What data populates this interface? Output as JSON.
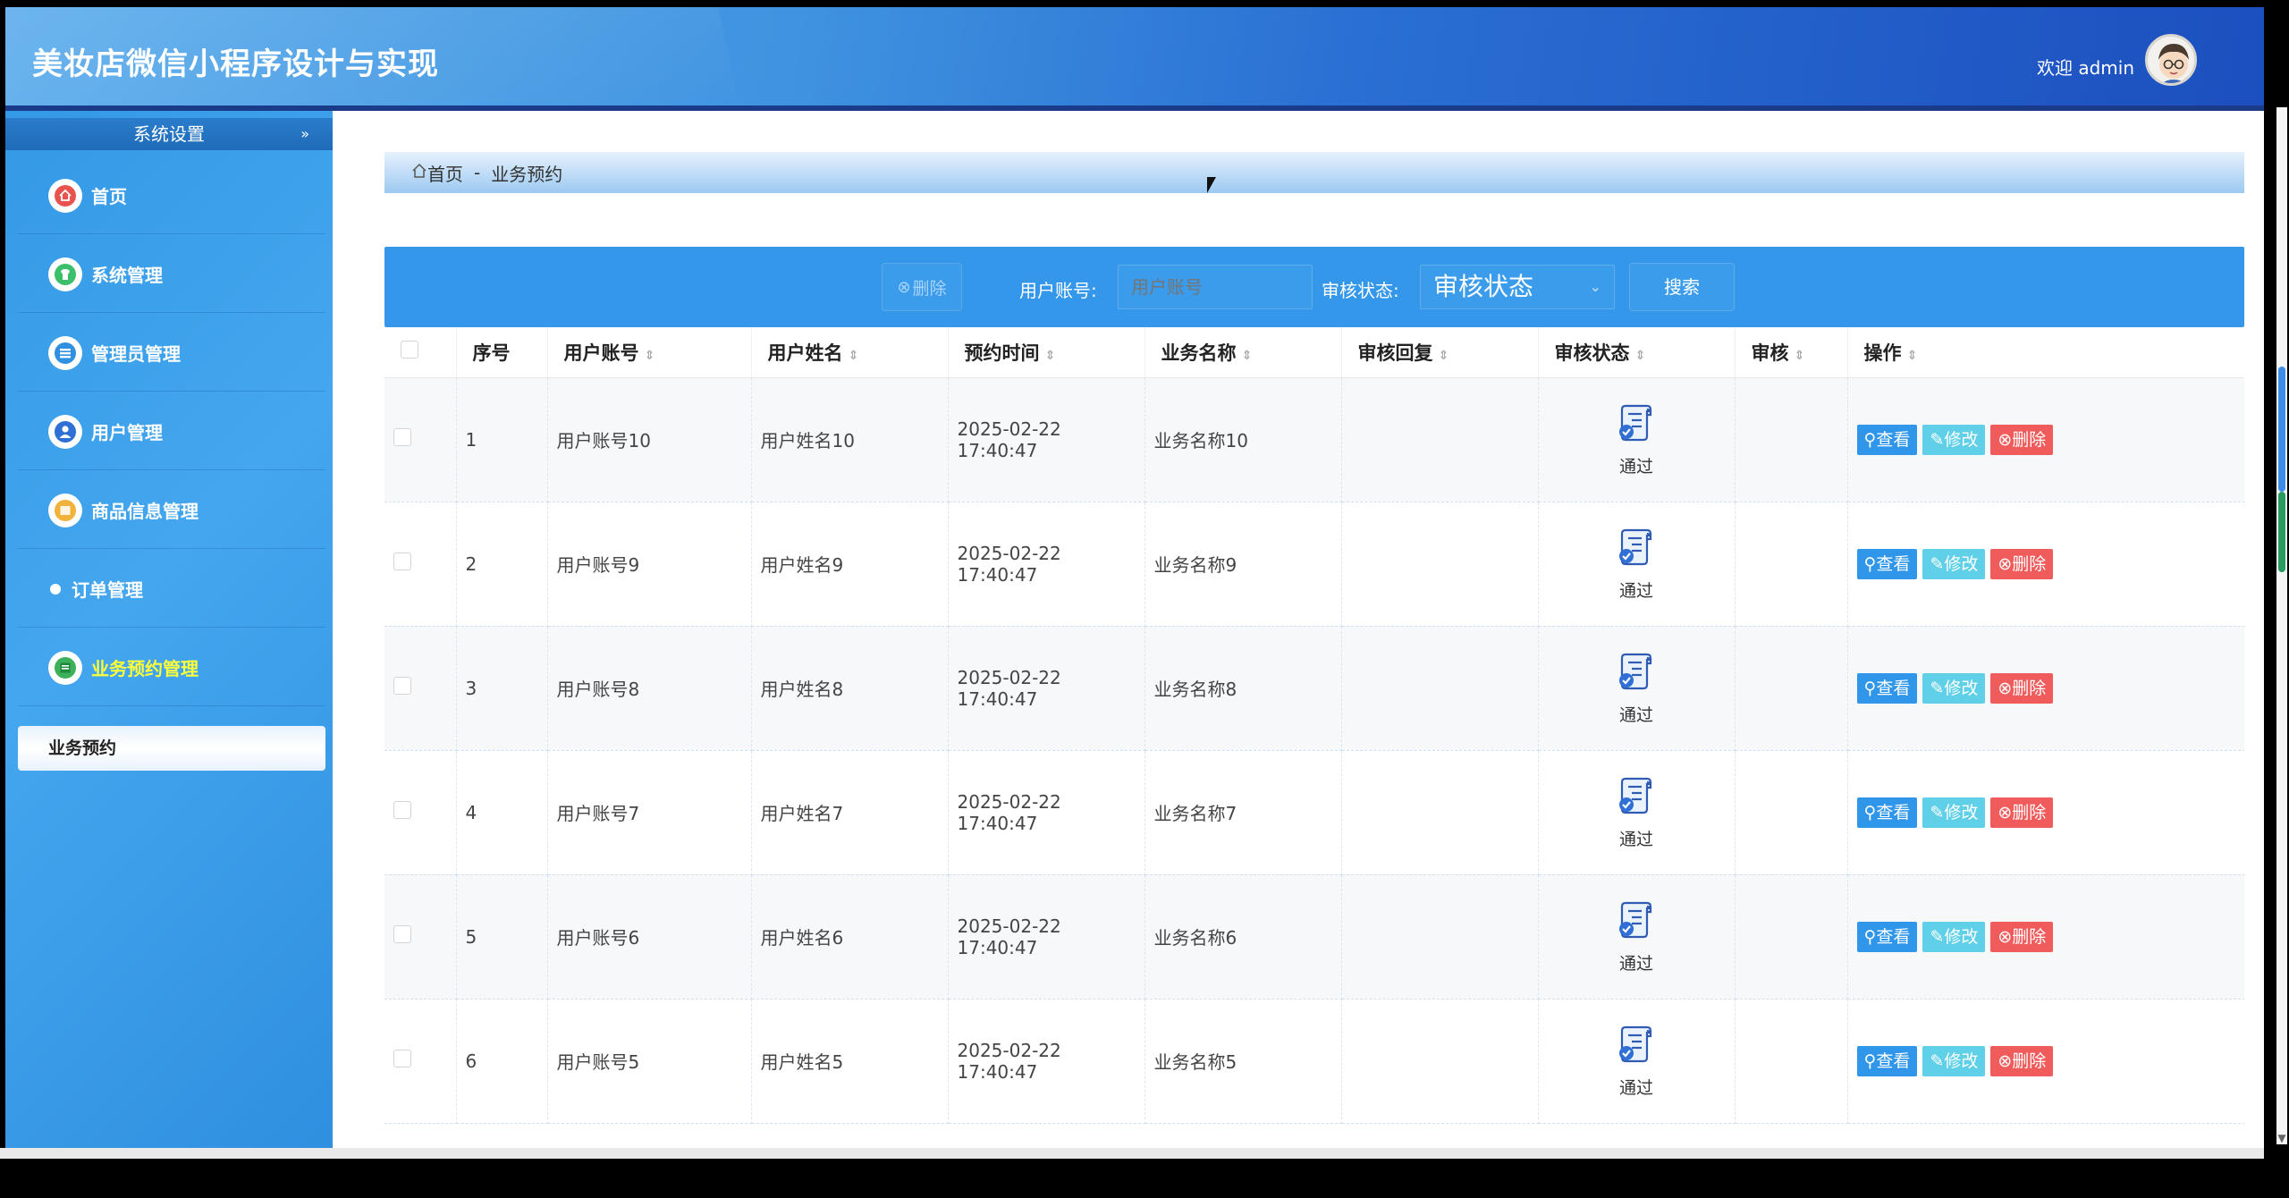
{
  "header": {
    "title": "美妆店微信小程序设计与实现",
    "welcome": "欢迎 admin"
  },
  "sidebar": {
    "section_title": "系统设置",
    "items": [
      {
        "label": "首页",
        "icon": "home-icon",
        "icon_color": "#e9534f"
      },
      {
        "label": "系统管理",
        "icon": "shirt-icon",
        "icon_color": "#3cbf6b"
      },
      {
        "label": "管理员管理",
        "icon": "list-icon",
        "icon_color": "#2f8fe0"
      },
      {
        "label": "用户管理",
        "icon": "user-icon",
        "icon_color": "#2f6fd6"
      },
      {
        "label": "商品信息管理",
        "icon": "box-icon",
        "icon_color": "#f0b23a"
      },
      {
        "label": "订单管理",
        "icon": "dot-icon",
        "icon_color": "#ffffff"
      },
      {
        "label": "业务预约管理",
        "icon": "calendar-icon",
        "icon_color": "#3cb05a",
        "active": true
      }
    ],
    "submenu_label": "业务预约"
  },
  "breadcrumb": {
    "home": "首页",
    "separator": "-",
    "current": "业务预约"
  },
  "search": {
    "delete_label": "删除",
    "account_label": "用户账号:",
    "account_placeholder": "用户账号",
    "status_label": "审核状态:",
    "status_select": "审核状态",
    "search_button": "搜索"
  },
  "table": {
    "headers": [
      "序号",
      "用户账号",
      "用户姓名",
      "预约时间",
      "业务名称",
      "审核回复",
      "审核状态",
      "审核",
      "操作"
    ],
    "rows": [
      {
        "index": "1",
        "account": "用户账号10",
        "name": "用户姓名10",
        "time": "2025-02-22 17:40:47",
        "business": "业务名称10",
        "reply": "",
        "status": "通过"
      },
      {
        "index": "2",
        "account": "用户账号9",
        "name": "用户姓名9",
        "time": "2025-02-22 17:40:47",
        "business": "业务名称9",
        "reply": "",
        "status": "通过"
      },
      {
        "index": "3",
        "account": "用户账号8",
        "name": "用户姓名8",
        "time": "2025-02-22 17:40:47",
        "business": "业务名称8",
        "reply": "",
        "status": "通过"
      },
      {
        "index": "4",
        "account": "用户账号7",
        "name": "用户姓名7",
        "time": "2025-02-22 17:40:47",
        "business": "业务名称7",
        "reply": "",
        "status": "通过"
      },
      {
        "index": "5",
        "account": "用户账号6",
        "name": "用户姓名6",
        "time": "2025-02-22 17:40:47",
        "business": "业务名称6",
        "reply": "",
        "status": "通过"
      },
      {
        "index": "6",
        "account": "用户账号5",
        "name": "用户姓名5",
        "time": "2025-02-22 17:40:47",
        "business": "业务名称5",
        "reply": "",
        "status": "通过"
      }
    ],
    "actions": {
      "view": "查看",
      "edit": "修改",
      "delete": "删除"
    }
  },
  "colors": {
    "primary": "#3497ea",
    "header_dark": "#1a3b8a",
    "view_button": "#2f96ea",
    "edit_button": "#5fd0e8",
    "delete_button": "#f05c5c",
    "active_menu_text": "#ffff3a"
  }
}
